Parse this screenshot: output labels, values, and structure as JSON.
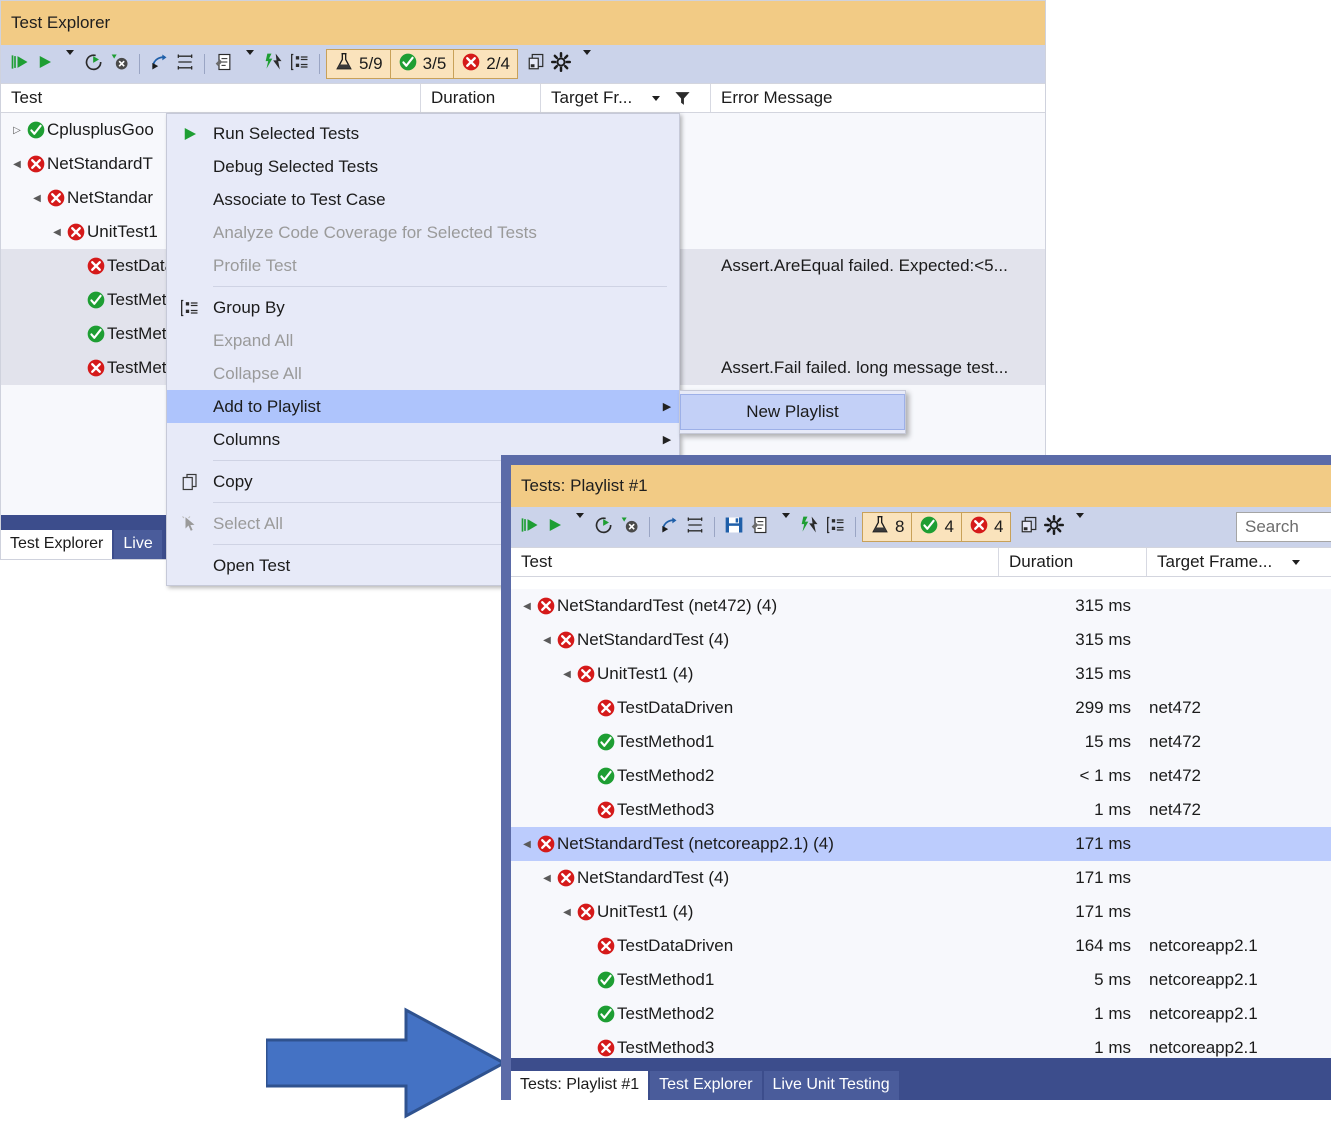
{
  "window1": {
    "title": "Test Explorer",
    "toolbar": {
      "buttons": [
        {
          "name": "run-all-tests",
          "icon": "run-all-icon"
        },
        {
          "name": "run-tests",
          "icon": "run-icon"
        },
        {
          "name": "run-dropdown",
          "icon": "chevron-down-icon"
        },
        {
          "name": "repeat-last-run",
          "icon": "repeat-run-icon"
        },
        {
          "name": "stop-test-run",
          "icon": "stop-icon"
        },
        {
          "name": "sep1",
          "icon": "separator"
        },
        {
          "name": "playlist-run",
          "icon": "playlist-run-icon"
        },
        {
          "name": "expand-collapse",
          "icon": "expand-collapse-icon"
        },
        {
          "name": "sep2",
          "icon": "separator"
        },
        {
          "name": "test-settings",
          "icon": "test-settings-icon"
        },
        {
          "name": "test-settings-dropdown",
          "icon": "chevron-down-icon"
        },
        {
          "name": "run-after-build",
          "icon": "lightning-icon"
        },
        {
          "name": "group-by",
          "icon": "group-by-icon"
        }
      ],
      "counts": [
        {
          "name": "total-tests",
          "icon": "flask-icon",
          "value": "5/9"
        },
        {
          "name": "passed-tests",
          "icon": "passed-icon",
          "value": "3/5"
        },
        {
          "name": "failed-tests",
          "icon": "failed-icon",
          "value": "2/4"
        }
      ],
      "trailing": [
        {
          "name": "output-window",
          "icon": "copy-window-icon"
        },
        {
          "name": "settings",
          "icon": "gear-icon"
        },
        {
          "name": "settings-dropdown",
          "icon": "chevron-down-icon"
        }
      ]
    },
    "columns": [
      {
        "name": "test",
        "label": "Test"
      },
      {
        "name": "duration",
        "label": "Duration"
      },
      {
        "name": "target-framework",
        "label": "Target Fr...",
        "sort": "chevron-down-icon",
        "filter": "funnel-icon"
      },
      {
        "name": "error-message",
        "label": "Error Message"
      }
    ],
    "rows": [
      {
        "indent": 0,
        "twisty": "collapsed",
        "status": "passed",
        "name": "CplusplusGoo",
        "error": ""
      },
      {
        "indent": 0,
        "twisty": "expanded",
        "status": "failed",
        "name": "NetStandardT",
        "error": ""
      },
      {
        "indent": 1,
        "twisty": "expanded",
        "status": "failed",
        "name": "NetStandar",
        "error": ""
      },
      {
        "indent": 2,
        "twisty": "expanded",
        "status": "failed",
        "name": "UnitTest1",
        "error": ""
      },
      {
        "indent": 3,
        "twisty": "none",
        "status": "failed",
        "name": "TestData",
        "error": "Assert.AreEqual failed. Expected:<5...",
        "selected": true
      },
      {
        "indent": 3,
        "twisty": "none",
        "status": "passed",
        "name": "TestMet",
        "error": "",
        "selected": true
      },
      {
        "indent": 3,
        "twisty": "none",
        "status": "passed",
        "name": "TestMet",
        "error": "",
        "selected": true
      },
      {
        "indent": 3,
        "twisty": "none",
        "status": "failed",
        "name": "TestMet",
        "error": "Assert.Fail failed. long message test...",
        "selected": true
      }
    ],
    "tabs": [
      {
        "name": "tab-test-explorer",
        "label": "Test Explorer",
        "active": true
      },
      {
        "name": "tab-live-unit-testing",
        "label": "Live",
        "active": false
      }
    ]
  },
  "context_menu": {
    "items": [
      {
        "name": "run-selected-tests",
        "label": "Run Selected Tests",
        "icon": "run-icon",
        "disabled": false,
        "highlighted": false,
        "submenu": false
      },
      {
        "name": "debug-selected-tests",
        "label": "Debug Selected Tests",
        "icon": "",
        "disabled": false,
        "highlighted": false,
        "submenu": false
      },
      {
        "name": "associate-to-test-case",
        "label": "Associate to Test Case",
        "icon": "",
        "disabled": false,
        "highlighted": false,
        "submenu": false
      },
      {
        "name": "analyze-code-coverage",
        "label": "Analyze Code Coverage for Selected Tests",
        "icon": "",
        "disabled": true,
        "highlighted": false,
        "submenu": false
      },
      {
        "name": "profile-test",
        "label": "Profile Test",
        "icon": "",
        "disabled": true,
        "highlighted": false,
        "submenu": false
      },
      {
        "name": "separator-1",
        "label": "",
        "separator": true
      },
      {
        "name": "group-by",
        "label": "Group By",
        "icon": "group-by-icon",
        "disabled": false,
        "highlighted": false,
        "submenu": false
      },
      {
        "name": "expand-all",
        "label": "Expand All",
        "icon": "",
        "disabled": true,
        "highlighted": false,
        "submenu": false
      },
      {
        "name": "collapse-all",
        "label": "Collapse All",
        "icon": "",
        "disabled": true,
        "highlighted": false,
        "submenu": false
      },
      {
        "name": "add-to-playlist",
        "label": "Add to Playlist",
        "icon": "",
        "disabled": false,
        "highlighted": true,
        "submenu": true
      },
      {
        "name": "columns",
        "label": "Columns",
        "icon": "",
        "disabled": false,
        "highlighted": false,
        "submenu": true
      },
      {
        "name": "separator-2",
        "label": "",
        "separator": true
      },
      {
        "name": "copy",
        "label": "Copy",
        "icon": "copy-icon",
        "disabled": false,
        "highlighted": false,
        "submenu": false
      },
      {
        "name": "separator-3",
        "label": "",
        "separator": true
      },
      {
        "name": "select-all",
        "label": "Select All",
        "icon": "select-all-icon",
        "disabled": true,
        "highlighted": false,
        "submenu": false
      },
      {
        "name": "separator-4",
        "label": "",
        "separator": true
      },
      {
        "name": "open-test",
        "label": "Open Test",
        "icon": "",
        "disabled": false,
        "highlighted": false,
        "submenu": false
      }
    ],
    "submenu": {
      "items": [
        {
          "name": "new-playlist",
          "label": "New Playlist",
          "highlighted": true
        }
      ]
    }
  },
  "window2": {
    "title": "Tests: Playlist #1",
    "toolbar": {
      "buttons": [
        {
          "name": "run-all-tests",
          "icon": "run-all-icon"
        },
        {
          "name": "run-tests",
          "icon": "run-icon"
        },
        {
          "name": "run-dropdown",
          "icon": "chevron-down-icon"
        },
        {
          "name": "repeat-last-run",
          "icon": "repeat-run-icon"
        },
        {
          "name": "stop-test-run",
          "icon": "stop-icon"
        },
        {
          "name": "sep1",
          "icon": "separator"
        },
        {
          "name": "playlist-run",
          "icon": "playlist-run-icon"
        },
        {
          "name": "expand-collapse",
          "icon": "expand-collapse-icon"
        },
        {
          "name": "sep2",
          "icon": "separator"
        },
        {
          "name": "save-playlist",
          "icon": "save-icon"
        },
        {
          "name": "test-settings",
          "icon": "test-settings-icon"
        },
        {
          "name": "test-settings-dropdown",
          "icon": "chevron-down-icon"
        },
        {
          "name": "run-after-build",
          "icon": "lightning-icon"
        },
        {
          "name": "group-by",
          "icon": "group-by-icon"
        }
      ],
      "counts": [
        {
          "name": "total-tests",
          "icon": "flask-icon",
          "value": "8"
        },
        {
          "name": "passed-tests",
          "icon": "passed-icon",
          "value": "4"
        },
        {
          "name": "failed-tests",
          "icon": "failed-icon",
          "value": "4"
        }
      ],
      "trailing": [
        {
          "name": "output-window",
          "icon": "copy-window-icon"
        },
        {
          "name": "settings",
          "icon": "gear-icon"
        },
        {
          "name": "settings-dropdown",
          "icon": "chevron-down-icon"
        }
      ],
      "search_placeholder": "Search"
    },
    "columns": [
      {
        "name": "test",
        "label": "Test"
      },
      {
        "name": "duration",
        "label": "Duration"
      },
      {
        "name": "target-framework",
        "label": "Target Frame...",
        "sort": "chevron-down-icon"
      }
    ],
    "rows": [
      {
        "indent": 0,
        "twisty": "expanded",
        "status": "failed",
        "name": "NetStandardTest (net472) (4)",
        "duration": "315 ms",
        "tfm": "",
        "selected": false
      },
      {
        "indent": 1,
        "twisty": "expanded",
        "status": "failed",
        "name": "NetStandardTest (4)",
        "duration": "315 ms",
        "tfm": "",
        "selected": false
      },
      {
        "indent": 2,
        "twisty": "expanded",
        "status": "failed",
        "name": "UnitTest1 (4)",
        "duration": "315 ms",
        "tfm": "",
        "selected": false
      },
      {
        "indent": 3,
        "twisty": "none",
        "status": "failed",
        "name": "TestDataDriven",
        "duration": "299 ms",
        "tfm": "net472",
        "selected": false
      },
      {
        "indent": 3,
        "twisty": "none",
        "status": "passed",
        "name": "TestMethod1",
        "duration": "15 ms",
        "tfm": "net472",
        "selected": false
      },
      {
        "indent": 3,
        "twisty": "none",
        "status": "passed",
        "name": "TestMethod2",
        "duration": "< 1 ms",
        "tfm": "net472",
        "selected": false
      },
      {
        "indent": 3,
        "twisty": "none",
        "status": "failed",
        "name": "TestMethod3",
        "duration": "1 ms",
        "tfm": "net472",
        "selected": false
      },
      {
        "indent": 0,
        "twisty": "expanded",
        "status": "failed",
        "name": "NetStandardTest (netcoreapp2.1) (4)",
        "duration": "171 ms",
        "tfm": "",
        "selected": true
      },
      {
        "indent": 1,
        "twisty": "expanded",
        "status": "failed",
        "name": "NetStandardTest (4)",
        "duration": "171 ms",
        "tfm": "",
        "selected": false
      },
      {
        "indent": 2,
        "twisty": "expanded",
        "status": "failed",
        "name": "UnitTest1 (4)",
        "duration": "171 ms",
        "tfm": "",
        "selected": false
      },
      {
        "indent": 3,
        "twisty": "none",
        "status": "failed",
        "name": "TestDataDriven",
        "duration": "164 ms",
        "tfm": "netcoreapp2.1",
        "selected": false
      },
      {
        "indent": 3,
        "twisty": "none",
        "status": "passed",
        "name": "TestMethod1",
        "duration": "5 ms",
        "tfm": "netcoreapp2.1",
        "selected": false
      },
      {
        "indent": 3,
        "twisty": "none",
        "status": "passed",
        "name": "TestMethod2",
        "duration": "1 ms",
        "tfm": "netcoreapp2.1",
        "selected": false
      },
      {
        "indent": 3,
        "twisty": "none",
        "status": "failed",
        "name": "TestMethod3",
        "duration": "1 ms",
        "tfm": "netcoreapp2.1",
        "selected": false
      }
    ],
    "tabs": [
      {
        "name": "tab-tests-playlist-1",
        "label": "Tests: Playlist #1",
        "active": true
      },
      {
        "name": "tab-test-explorer",
        "label": "Test Explorer",
        "active": false
      },
      {
        "name": "tab-live-unit-testing",
        "label": "Live Unit Testing",
        "active": false
      }
    ]
  },
  "annotation": {
    "arrow": {
      "name": "blue-arrow-annotation",
      "fill": "#4472C4",
      "stroke": "#2F528F"
    }
  },
  "colors": {
    "title_bar": "#F2CB85",
    "toolbar": "#CBD3EA",
    "menu_bg": "#E7EAF8",
    "menu_highlight": "#AEC4FC",
    "row_selected_w1": "#E2E3EC",
    "row_selected_w2": "#BCCCFD",
    "grid_bg": "#F7F8FC",
    "tabbar": "#3C4D8C",
    "pass_green": "#1E9E33",
    "fail_red": "#D51A1A",
    "window_border": "#5B6BA8"
  }
}
